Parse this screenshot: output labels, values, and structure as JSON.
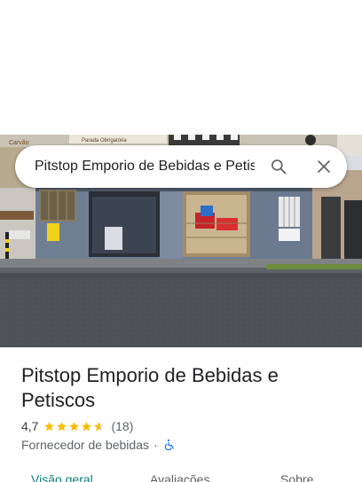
{
  "search": {
    "value": "Pitstop Emporio de Bebidas e Petisco",
    "search_icon": "search-icon",
    "close_icon": "close-icon"
  },
  "photo": {
    "sign_text": "Parada Obrigatória",
    "sign_left_text": "Carvão"
  },
  "place": {
    "title": "Pitstop Emporio de Bebidas e Petiscos",
    "rating": "4,7",
    "stars": 4.7,
    "review_count": "(18)",
    "category": "Fornecedor de bebidas",
    "separator": "·",
    "accessibility_icon": "wheelchair-icon"
  },
  "tabs": {
    "overview": "Visão geral",
    "reviews": "Avaliações",
    "about": "Sobre"
  },
  "colors": {
    "accent": "#0b7f80",
    "star": "#fbbc04",
    "accessibility": "#1a73e8"
  }
}
